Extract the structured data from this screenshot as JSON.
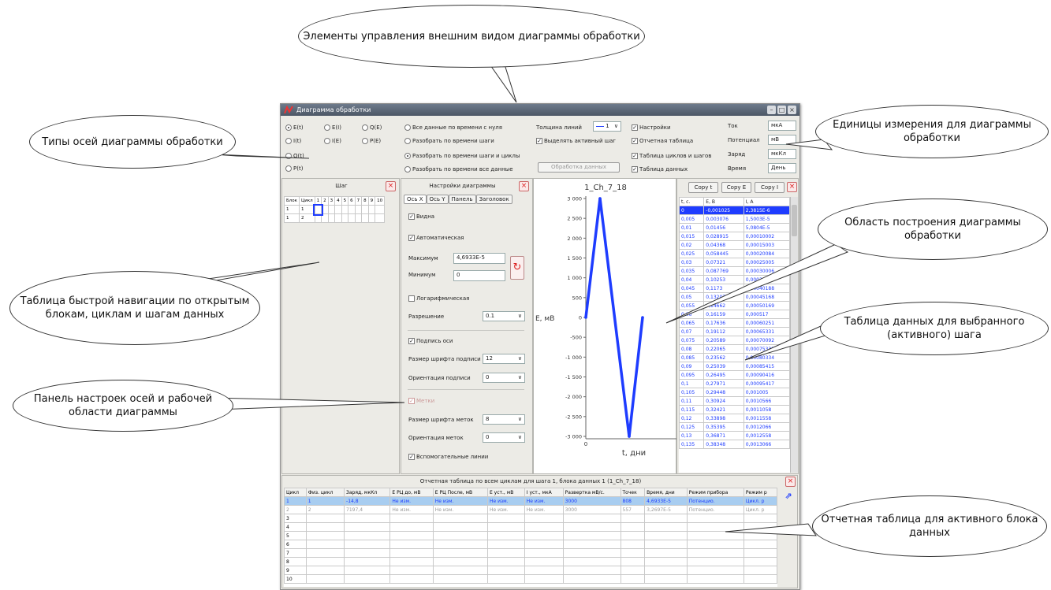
{
  "window": {
    "title": "Диаграмма обработки"
  },
  "axes_types": [
    "E(t)",
    "E(I)",
    "Q(E)",
    "I(t)",
    "I(E)",
    "P(E)",
    "Q(t)",
    "P(t)"
  ],
  "split_options": [
    "Все данные по времени с нуля",
    "Разобрать по времени шаги",
    "Разобрать по времени шаги и циклы",
    "Разобрать по времени все данные"
  ],
  "line": {
    "label": "Толщина линий",
    "value": "1",
    "highlight": "Выделять активный шаг",
    "process_btn": "Обработка данных"
  },
  "toggles": [
    "Настройки",
    "Отчетная таблица",
    "Таблица циклов и шагов",
    "Таблица данных"
  ],
  "units": [
    {
      "label": "Ток",
      "value": "мкА"
    },
    {
      "label": "Потенциал",
      "value": "мВ"
    },
    {
      "label": "Заряд",
      "value": "мкКл"
    },
    {
      "label": "Время",
      "value": "День"
    }
  ],
  "step_panel": {
    "title": "Шаг",
    "headers": [
      "Блок",
      "Цикл",
      "1",
      "2",
      "3",
      "4",
      "5",
      "6",
      "7",
      "8",
      "9",
      "10"
    ],
    "rows": [
      [
        "1",
        "1"
      ],
      [
        "1",
        "2"
      ]
    ]
  },
  "settings_panel": {
    "title": "Настройки диаграммы",
    "tabs": [
      "Ось X",
      "Ось Y",
      "Панель",
      "Заголовок"
    ],
    "visible": "Видна",
    "auto": "Автоматическая",
    "max_label": "Максимум",
    "max_value": "4,6933E-5",
    "min_label": "Минимум",
    "min_value": "0",
    "log": "Логарифмическая",
    "res_label": "Разрешение",
    "res_value": "0.1",
    "axis_caption": "Подпись оси",
    "cap_font_label": "Размер шрифта подписи",
    "cap_font_value": "12",
    "cap_orient_label": "Ориентация подписи",
    "cap_orient_value": "0",
    "marks": "Метки",
    "mark_font_label": "Размер шрифта меток",
    "mark_font_value": "8",
    "mark_orient_label": "Ориентация меток",
    "mark_orient_value": "0",
    "gridlines": "Вспомогательные линии"
  },
  "chart_data": {
    "type": "line",
    "title": "1_Ch_7_18",
    "xlabel": "t, дни",
    "ylabel": "E, мВ",
    "ylim": [
      -3000,
      3000
    ],
    "yticks": [
      "3 000",
      "2 500",
      "2 000",
      "1 500",
      "1 000",
      "500",
      "0",
      "-500",
      "-1 000",
      "-1 500",
      "-2 000",
      "-2 500",
      "-3 000"
    ],
    "xtick": "0",
    "series": [
      {
        "values": [
          [
            0,
            0
          ],
          [
            0.18,
            3000
          ],
          [
            0.55,
            -3000
          ],
          [
            0.72,
            0
          ]
        ]
      }
    ],
    "color": "#1e3cff"
  },
  "data_table": {
    "buttons": [
      "Copy t",
      "Copy E",
      "Copy I"
    ],
    "headers": [
      "t, с.",
      "E, В",
      "I, A"
    ],
    "rows": [
      [
        "0",
        "-0,001025",
        "2,3815E-6"
      ],
      [
        "0,005",
        "0,003076",
        "1,5003E-5"
      ],
      [
        "0,01",
        "0,01456",
        "5,0804E-5"
      ],
      [
        "0,015",
        "0,028915",
        "0,00010002"
      ],
      [
        "0,02",
        "0,04368",
        "0,00015003"
      ],
      [
        "0,025",
        "0,058445",
        "0,00020084"
      ],
      [
        "0,03",
        "0,07321",
        "0,00025005"
      ],
      [
        "0,035",
        "0,087769",
        "0,00030006"
      ],
      [
        "0,04",
        "0,10253",
        "0,00035007"
      ],
      [
        "0,045",
        "0,1173",
        "0,00040188"
      ],
      [
        "0,05",
        "0,13207",
        "0,00045168"
      ],
      [
        "0,055",
        "0,14662",
        "0,00050169"
      ],
      [
        "0,06",
        "0,16159",
        "0,000517"
      ],
      [
        "0,065",
        "0,17636",
        "0,00060251"
      ],
      [
        "0,07",
        "0,19112",
        "0,00065331"
      ],
      [
        "0,075",
        "0,20589",
        "0,00070092"
      ],
      [
        "0,08",
        "0,22065",
        "0,00075333"
      ],
      [
        "0,085",
        "0,23562",
        "0,00080334"
      ],
      [
        "0,09",
        "0,25039",
        "0,00085415"
      ],
      [
        "0,095",
        "0,26495",
        "0,00090416"
      ],
      [
        "0,1",
        "0,27971",
        "0,00095417"
      ],
      [
        "0,105",
        "0,29448",
        "0,001005"
      ],
      [
        "0,11",
        "0,30924",
        "0,0010566"
      ],
      [
        "0,115",
        "0,32421",
        "0,0011058"
      ],
      [
        "0,12",
        "0,33898",
        "0,0011558"
      ],
      [
        "0,125",
        "0,35395",
        "0,0012066"
      ],
      [
        "0,13",
        "0,36871",
        "0,0012558"
      ],
      [
        "0,135",
        "0,38348",
        "0,0013066"
      ]
    ]
  },
  "report": {
    "title": "Отчетная таблица по всем циклам для шага 1, блока данных 1 (1_Ch_7_18)",
    "headers": [
      "Цикл",
      "Физ. цикл",
      "Заряд, мкКл",
      "E РЦ до, мВ",
      "E РЦ После, мВ",
      "E уст., мВ",
      "I уст., мкА",
      "Развертка мВ/с.",
      "Точек",
      "Время, дни",
      "Режим прибора",
      "Режим р"
    ],
    "rows": [
      [
        "1",
        "1",
        "-14,8",
        "Не изм.",
        "Не изм.",
        "Не изм.",
        "Не изм.",
        "3000",
        "808",
        "4,6933E-5",
        "Потенцио.",
        "Цикл. р"
      ],
      [
        "2",
        "2",
        "7197,4",
        "Не изм.",
        "Не изм.",
        "Не изм.",
        "Не изм.",
        "3000",
        "557",
        "3,2697E-5",
        "Потенцио.",
        "Цикл. р"
      ],
      [
        "3"
      ],
      [
        "4"
      ],
      [
        "5"
      ],
      [
        "6"
      ],
      [
        "7"
      ],
      [
        "8"
      ],
      [
        "9"
      ],
      [
        "10"
      ]
    ]
  },
  "callouts": {
    "top": "Элементы управления внешним видом диаграммы обработки",
    "axes": "Типы осей диаграммы обработки",
    "units": "Единицы измерения для диаграммы обработки",
    "plot": "Область построения диаграммы обработки",
    "nav": "Таблица быстрой навигации по открытым блокам, циклам и шагам данных",
    "datatable": "Таблица данных для выбранного (активного) шага",
    "settings": "Панель настроек осей и рабочей области диаграммы",
    "report": "Отчетная таблица для активного блока данных"
  }
}
